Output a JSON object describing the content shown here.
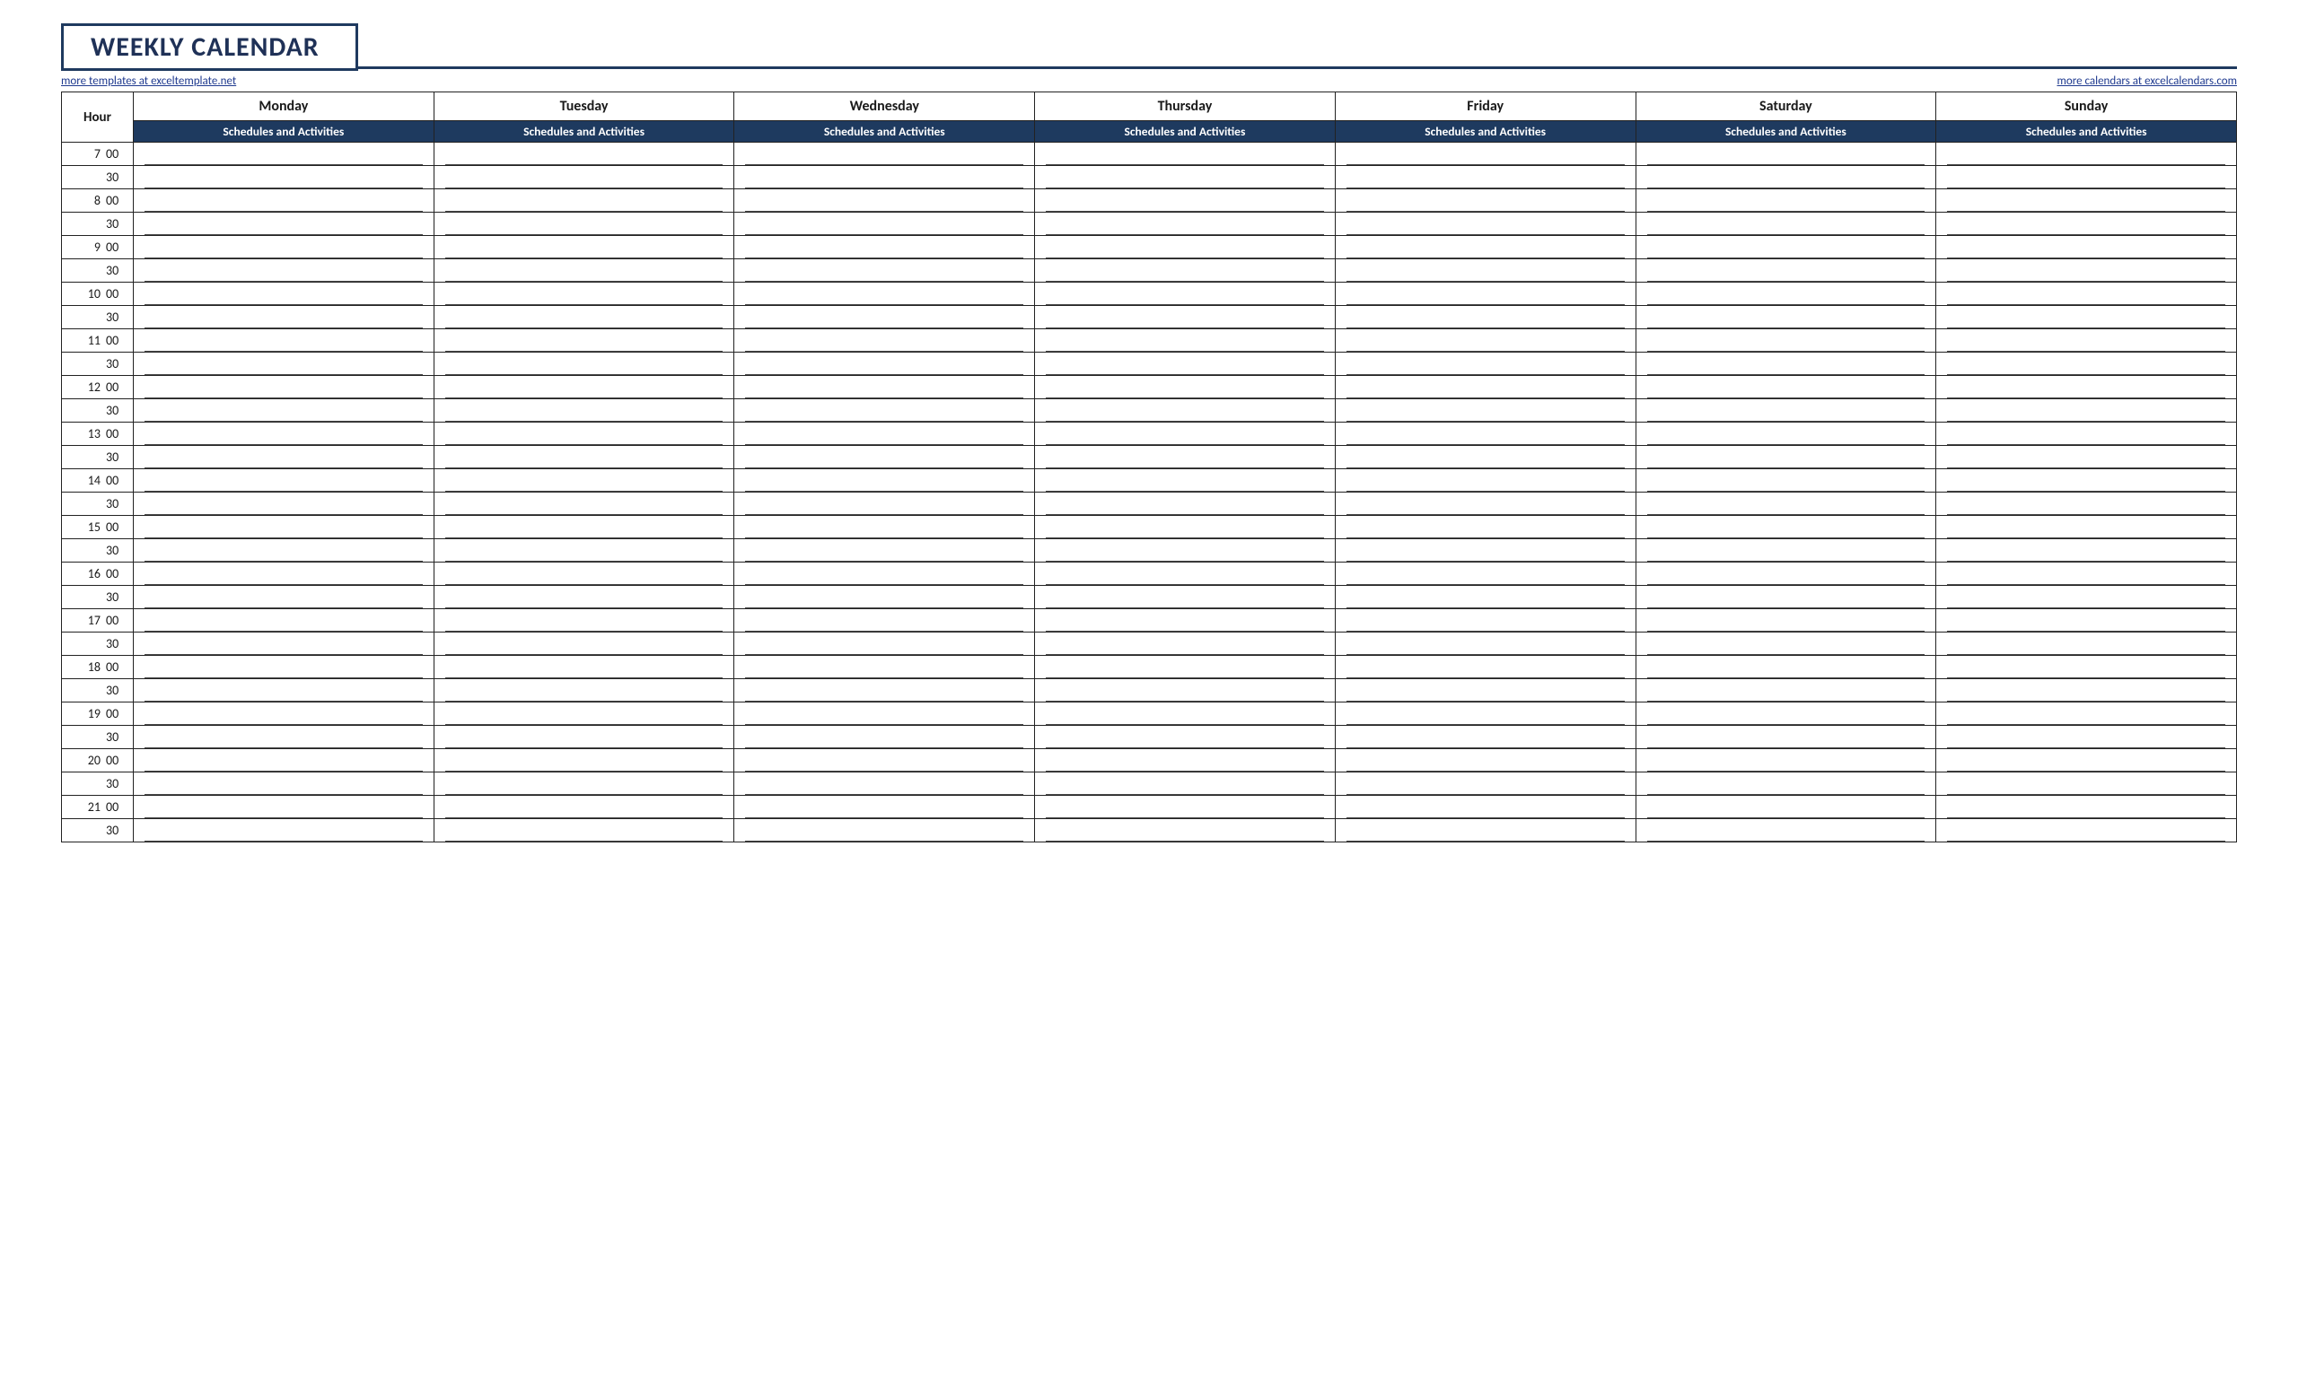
{
  "title": "WEEKLY CALENDAR",
  "links": {
    "left": "more templates at exceltemplate.net",
    "right": "more calendars at excelcalendars.com"
  },
  "headers": {
    "hour": "Hour",
    "days": [
      "Monday",
      "Tuesday",
      "Wednesday",
      "Thursday",
      "Friday",
      "Saturday",
      "Sunday"
    ],
    "sub": "Schedules and Activities"
  },
  "time_slots": [
    {
      "hour": "7",
      "minute": "00"
    },
    {
      "hour": "",
      "minute": "30"
    },
    {
      "hour": "8",
      "minute": "00"
    },
    {
      "hour": "",
      "minute": "30"
    },
    {
      "hour": "9",
      "minute": "00"
    },
    {
      "hour": "",
      "minute": "30"
    },
    {
      "hour": "10",
      "minute": "00"
    },
    {
      "hour": "",
      "minute": "30"
    },
    {
      "hour": "11",
      "minute": "00"
    },
    {
      "hour": "",
      "minute": "30"
    },
    {
      "hour": "12",
      "minute": "00"
    },
    {
      "hour": "",
      "minute": "30"
    },
    {
      "hour": "13",
      "minute": "00"
    },
    {
      "hour": "",
      "minute": "30"
    },
    {
      "hour": "14",
      "minute": "00"
    },
    {
      "hour": "",
      "minute": "30"
    },
    {
      "hour": "15",
      "minute": "00"
    },
    {
      "hour": "",
      "minute": "30"
    },
    {
      "hour": "16",
      "minute": "00"
    },
    {
      "hour": "",
      "minute": "30"
    },
    {
      "hour": "17",
      "minute": "00"
    },
    {
      "hour": "",
      "minute": "30"
    },
    {
      "hour": "18",
      "minute": "00"
    },
    {
      "hour": "",
      "minute": "30"
    },
    {
      "hour": "19",
      "minute": "00"
    },
    {
      "hour": "",
      "minute": "30"
    },
    {
      "hour": "20",
      "minute": "00"
    },
    {
      "hour": "",
      "minute": "30"
    },
    {
      "hour": "21",
      "minute": "00"
    },
    {
      "hour": "",
      "minute": "30"
    }
  ]
}
